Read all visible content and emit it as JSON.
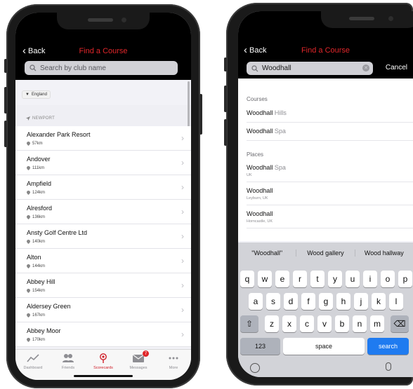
{
  "left": {
    "nav": {
      "back": "Back",
      "title": "Find a Course",
      "search_placeholder": "Search by club name"
    },
    "filter": "England",
    "section": "NEWPORT",
    "courses": [
      {
        "name": "Alexander Park Resort",
        "distance": "57km"
      },
      {
        "name": "Andover",
        "distance": "111km"
      },
      {
        "name": "Ampfield",
        "distance": "124km"
      },
      {
        "name": "Alresford",
        "distance": "136km"
      },
      {
        "name": "Ansty Golf Centre Ltd",
        "distance": "140km"
      },
      {
        "name": "Alton",
        "distance": "144km"
      },
      {
        "name": "Abbey Hill",
        "distance": "154km"
      },
      {
        "name": "Aldersey Green",
        "distance": "167km"
      },
      {
        "name": "Abbey Moor",
        "distance": "170km"
      }
    ],
    "tabs": [
      {
        "label": "Dashboard",
        "icon": "chart-line-icon"
      },
      {
        "label": "Friends",
        "icon": "friends-icon"
      },
      {
        "label": "Scorecards",
        "icon": "scorecard-icon"
      },
      {
        "label": "Messages",
        "icon": "mail-icon",
        "badge": "7"
      },
      {
        "label": "More",
        "icon": "more-icon"
      }
    ],
    "active_tab": "Scorecards"
  },
  "right": {
    "nav": {
      "back": "Back",
      "title": "Find a Course",
      "search_value": "Woodhall",
      "cancel": "Cancel"
    },
    "courses_header": "Courses",
    "courses": [
      {
        "match": "Woodhall",
        "rest": " Hills"
      },
      {
        "match": "Woodhall",
        "rest": " Spa"
      }
    ],
    "places_header": "Places",
    "places": [
      {
        "match": "Woodhall",
        "rest": " Spa",
        "sub": "UK"
      },
      {
        "match": "Woodhall",
        "rest": "",
        "sub": "Leyburn, UK"
      },
      {
        "match": "Woodhall",
        "rest": "",
        "sub": "Horncastle, UK"
      }
    ],
    "suggestions": [
      "\"Woodhall\"",
      "Wood gallery",
      "Wood hallway"
    ],
    "keys": {
      "row1": [
        "q",
        "w",
        "e",
        "r",
        "t",
        "y",
        "u",
        "i",
        "o",
        "p"
      ],
      "row2": [
        "a",
        "s",
        "d",
        "f",
        "g",
        "h",
        "j",
        "k",
        "l"
      ],
      "row3": [
        "z",
        "x",
        "c",
        "v",
        "b",
        "n",
        "m"
      ],
      "numbers": "123",
      "space": "space",
      "search": "search"
    }
  },
  "colors": {
    "accent": "#e0262a",
    "navbar": "#000000",
    "keyboard_blue": "#1f7bf0"
  }
}
